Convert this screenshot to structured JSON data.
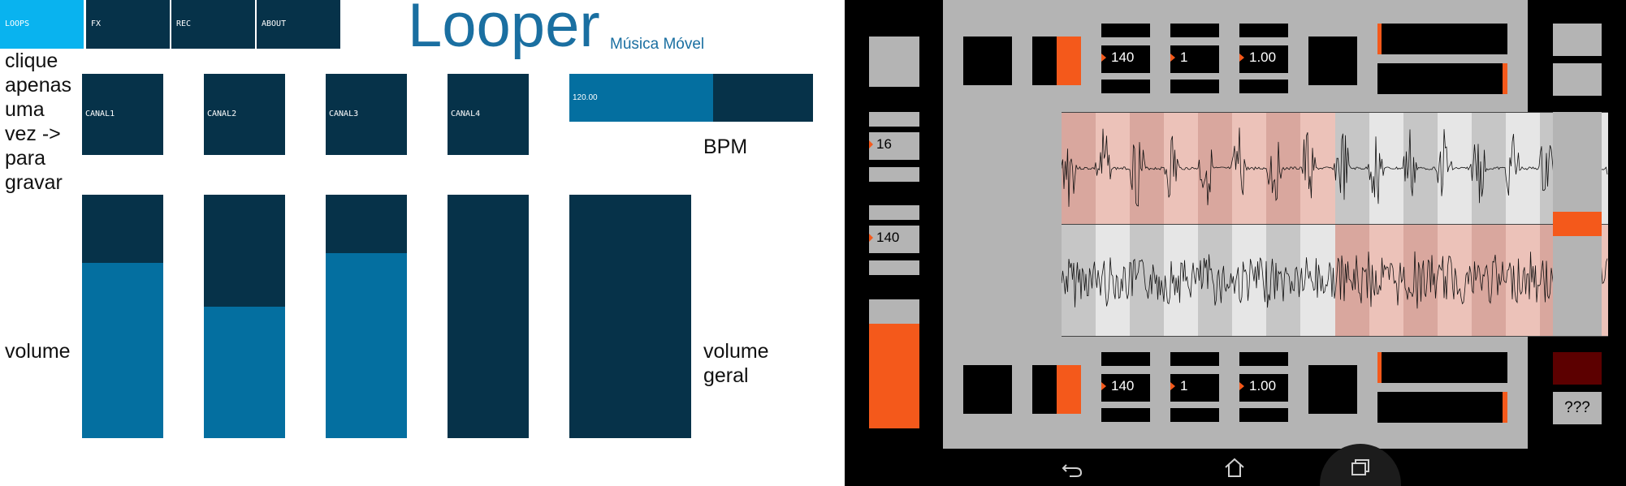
{
  "looper": {
    "tabs": [
      {
        "label": "LOOPS",
        "active": true
      },
      {
        "label": "FX",
        "active": false
      },
      {
        "label": "REC",
        "active": false
      },
      {
        "label": "ABOUT",
        "active": false
      }
    ],
    "title": "Looper",
    "subtitle": "Música Móvel",
    "instruction_lines": [
      "clique",
      "apenas",
      "uma",
      "vez ->",
      "para",
      "gravar"
    ],
    "channels": [
      {
        "label": "CANAL1",
        "volume_level": 0.72
      },
      {
        "label": "CANAL2",
        "volume_level": 0.54
      },
      {
        "label": "CANAL3",
        "volume_level": 0.76
      },
      {
        "label": "CANAL4",
        "volume_level": 0.0
      }
    ],
    "bpm_slider": {
      "value": "120.00",
      "level": 0.59
    },
    "bpm_label": "BPM",
    "volume_label": "volume",
    "master_volume_label_lines": [
      "volume",
      "geral"
    ],
    "master_volume_level": 0.0,
    "colors": {
      "tab": "#063249",
      "tab_active": "#09b3ef",
      "fill": "#046fa0",
      "title": "#1a6fa1"
    }
  },
  "mixer": {
    "deck_top": {
      "bpm": "140",
      "beats": "1",
      "rate": "1.00",
      "level_bar_a": 0.03,
      "level_bar_b": 0.04
    },
    "deck_bottom": {
      "bpm": "140",
      "beats": "1",
      "rate": "1.00",
      "level_bar_a": 0.03,
      "level_bar_b": 0.04
    },
    "left_panel": {
      "value_a": "16",
      "value_b": "140",
      "level": 0.81
    },
    "right_panel": {
      "slider_level": 0.5,
      "button_label": "???"
    },
    "icons": [
      "back-icon",
      "home-icon",
      "recent-apps-icon"
    ],
    "colors": {
      "accent": "#f4591b",
      "panel": "#b4b4b4",
      "wave_pink": "#e7b7ae",
      "wave_gray": "#dcdcdc",
      "dark_red": "#5c0000"
    }
  }
}
